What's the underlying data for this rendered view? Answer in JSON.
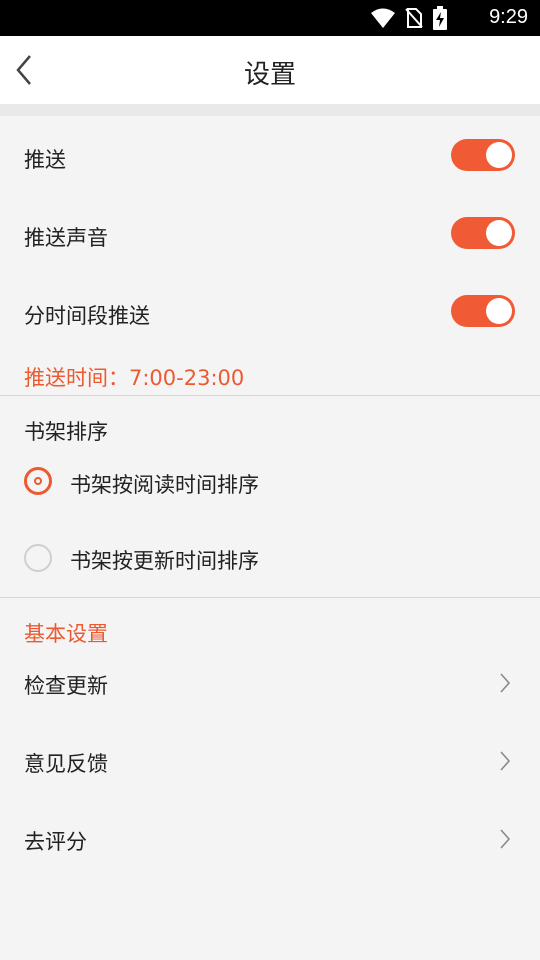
{
  "status_bar": {
    "time": "9:29",
    "icons": [
      "wifi-icon",
      "no-sim-icon",
      "battery-charging-icon"
    ]
  },
  "app_bar": {
    "title": "设置",
    "back_icon": "back-chevron-icon"
  },
  "push": {
    "items": [
      {
        "label": "推送",
        "enabled": true
      },
      {
        "label": "推送声音",
        "enabled": true
      },
      {
        "label": "分时间段推送",
        "enabled": true
      }
    ],
    "time_text": "推送时间：7:00-23:00"
  },
  "bookshelf": {
    "title": "书架排序",
    "options": [
      {
        "label": "书架按阅读时间排序",
        "selected": true
      },
      {
        "label": "书架按更新时间排序",
        "selected": false
      }
    ]
  },
  "basic": {
    "title": "基本设置",
    "items": [
      {
        "label": "检查更新"
      },
      {
        "label": "意见反馈"
      },
      {
        "label": "去评分"
      }
    ]
  },
  "colors": {
    "accent": "#ec5a32",
    "switch_on": "#f05a34",
    "background": "#f4f4f4"
  }
}
